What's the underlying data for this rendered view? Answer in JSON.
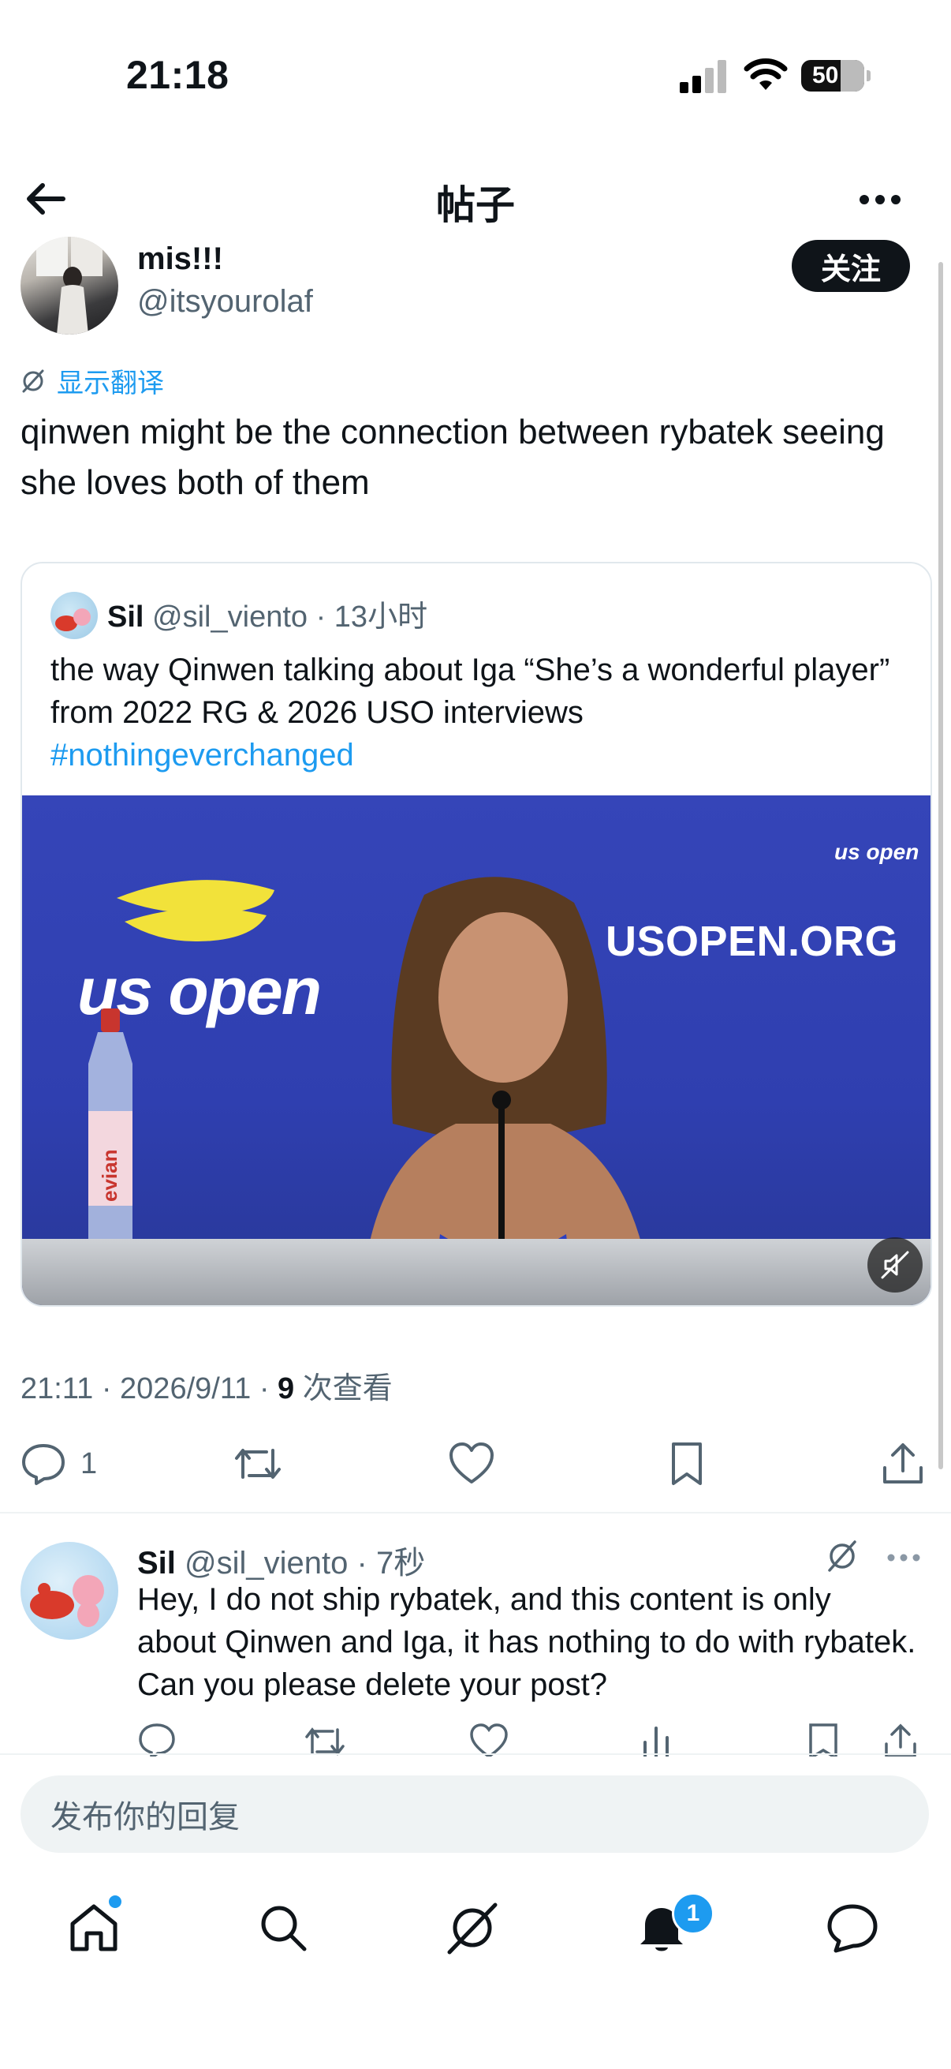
{
  "status_bar": {
    "time": "21:18",
    "battery": "50"
  },
  "header": {
    "title": "帖子",
    "back_icon": "arrow-left-icon",
    "more_icon": "more-horizontal-icon"
  },
  "post": {
    "author_name": "mis!!!",
    "author_handle": "@itsyourolaf",
    "follow_label": "关注",
    "translate_label": "显示翻译",
    "text": "qinwen might be the connection between rybatek seeing she loves both of them",
    "timestamp": "21:11 · 2026/9/11 · ",
    "views_count": "9",
    "views_label": " 次查看",
    "reply_count": "1"
  },
  "quote": {
    "name": "Sil",
    "handle": "@sil_viento",
    "time": " · 13小时",
    "text": "the way Qinwen talking about Iga “She’s a wonderful player” from 2022 RG & 2026 USO interviews",
    "hashtag": "#nothingeverchanged",
    "video": {
      "logo_text": "us open",
      "board_text": "USOPEN.ORG",
      "corner_text": "us open",
      "bottle_text": "evian"
    }
  },
  "reply": {
    "name": "Sil",
    "handle": "@sil_viento",
    "time": " · 7秒",
    "text": "Hey, I do not ship rybatek, and this content is only about Qinwen and Iga, it has nothing to do with rybatek. Can you please delete your post?"
  },
  "composer": {
    "placeholder": "发布你的回复"
  },
  "tabbar": {
    "notifications_badge": "1"
  },
  "colors": {
    "accent": "#1d9bf0",
    "text": "#0f1419",
    "muted": "#536471",
    "video_bg": "#3142b5"
  }
}
